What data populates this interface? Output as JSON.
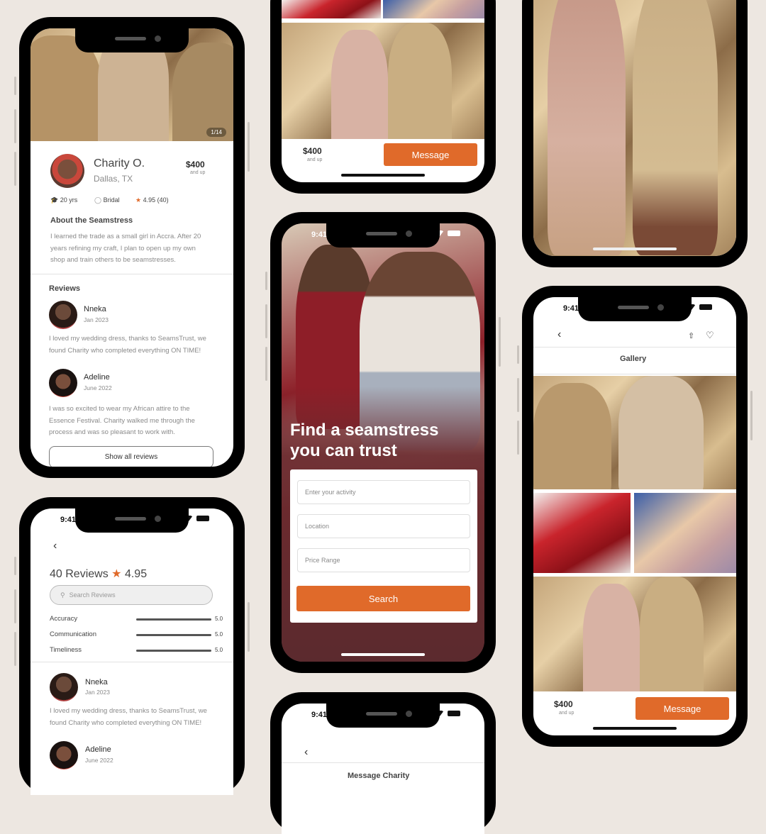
{
  "status": {
    "time": "9:41"
  },
  "profile": {
    "photo_counter": "1/14",
    "name": "Charity O.",
    "location": "Dallas, TX",
    "price": "$400",
    "price_note": "and up",
    "experience": "20 yrs",
    "specialty": "Bridal",
    "rating": "4.95 (40)",
    "about_title": "About the Seamstress",
    "about_text": "I learned the trade as a small girl in Accra. After 20 years refining my craft, I plan to open up my own shop and train others to be seamstresses.",
    "reviews_title": "Reviews",
    "show_all": "Show all reviews"
  },
  "reviews": [
    {
      "name": "Nneka",
      "date": "Jan 2023",
      "text": "I loved my wedding dress, thanks to SeamsTrust, we found Charity who completed everything ON TIME!"
    },
    {
      "name": "Adeline",
      "date": "June 2022",
      "text": "I was so excited to wear my African attire to the Essence Festival. Charity walked me through the process and was so pleasant to work with."
    }
  ],
  "reviews_page": {
    "heading": "40 Reviews",
    "rating": "4.95",
    "search_placeholder": "Search Reviews",
    "metrics": [
      {
        "label": "Accuracy",
        "value": "5.0",
        "fill": 1.0
      },
      {
        "label": "Communication",
        "value": "5.0",
        "fill": 1.0
      },
      {
        "label": "Timeliness",
        "value": "5.0",
        "fill": 1.0
      }
    ]
  },
  "listing": {
    "price": "$400",
    "price_note": "and up",
    "message": "Message"
  },
  "home": {
    "headline_1": "Find a seamstress",
    "headline_2": "you can trust",
    "activity_placeholder": "Enter your activity",
    "location_placeholder": "Location",
    "price_placeholder": "Price Range",
    "search": "Search"
  },
  "gallery": {
    "title": "Gallery"
  },
  "message_page": {
    "title": "Message Charity"
  },
  "colors": {
    "accent": "#e06a2a",
    "background": "#ede7e1",
    "hero_overlay": "#6b2a2e"
  }
}
